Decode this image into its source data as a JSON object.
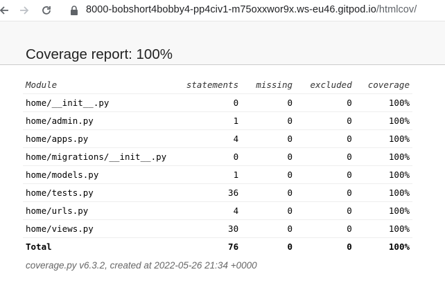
{
  "browser": {
    "url_host": "8000-bobshort4bobby4-pp4civ1-m75oxxwor9x.ws-eu46.gitpod.io",
    "url_path": "/htmlcov/"
  },
  "header": {
    "title": "Coverage report: 100%"
  },
  "table": {
    "headers": [
      "Module",
      "statements",
      "missing",
      "excluded",
      "coverage"
    ],
    "rows": [
      {
        "module": "home/__init__.py",
        "statements": "0",
        "missing": "0",
        "excluded": "0",
        "coverage": "100%"
      },
      {
        "module": "home/admin.py",
        "statements": "1",
        "missing": "0",
        "excluded": "0",
        "coverage": "100%"
      },
      {
        "module": "home/apps.py",
        "statements": "4",
        "missing": "0",
        "excluded": "0",
        "coverage": "100%"
      },
      {
        "module": "home/migrations/__init__.py",
        "statements": "0",
        "missing": "0",
        "excluded": "0",
        "coverage": "100%"
      },
      {
        "module": "home/models.py",
        "statements": "1",
        "missing": "0",
        "excluded": "0",
        "coverage": "100%"
      },
      {
        "module": "home/tests.py",
        "statements": "36",
        "missing": "0",
        "excluded": "0",
        "coverage": "100%"
      },
      {
        "module": "home/urls.py",
        "statements": "4",
        "missing": "0",
        "excluded": "0",
        "coverage": "100%"
      },
      {
        "module": "home/views.py",
        "statements": "30",
        "missing": "0",
        "excluded": "0",
        "coverage": "100%"
      }
    ],
    "total": {
      "module": "Total",
      "statements": "76",
      "missing": "0",
      "excluded": "0",
      "coverage": "100%"
    }
  },
  "footer": {
    "text": "coverage.py v6.3.2, created at 2022-05-26 21:34 +0000"
  }
}
